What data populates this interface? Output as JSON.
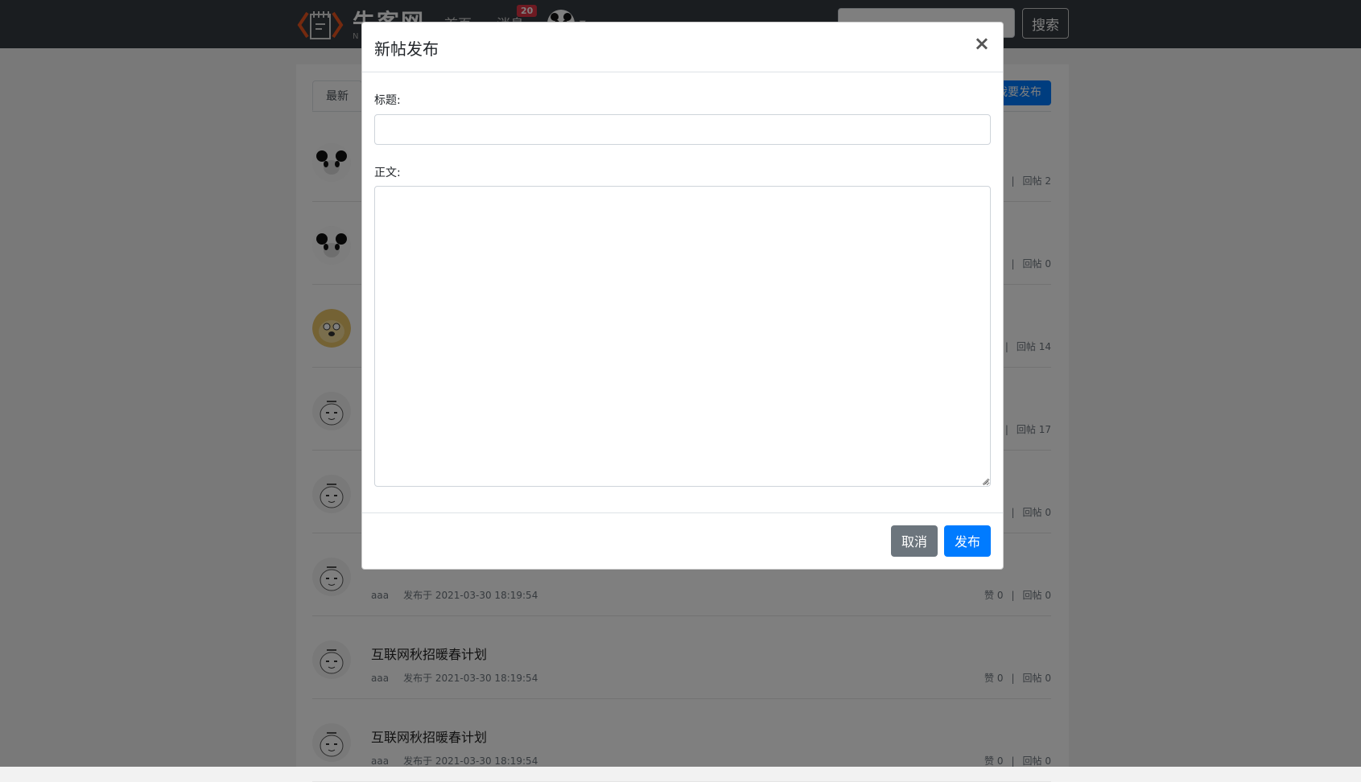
{
  "navbar": {
    "logo_text": "牛客网",
    "logo_sub": "N",
    "home_label": "首页",
    "messages_label": "消息",
    "messages_badge": "20",
    "search_button": "搜索"
  },
  "content": {
    "tab_latest": "最新",
    "publish_button": "我要发布",
    "posts": [
      {
        "title": "",
        "author": "",
        "time": "",
        "likes": "",
        "replies": "回帖 2",
        "avatar": "panda-avatar"
      },
      {
        "title": "",
        "author": "",
        "time": "",
        "likes": "",
        "replies": "回帖 0",
        "avatar": "panda-avatar"
      },
      {
        "title": "",
        "author": "",
        "time": "",
        "likes": "",
        "replies": "回帖 14",
        "avatar": "doge-avatar"
      },
      {
        "title": "",
        "author": "",
        "time": "",
        "likes": "",
        "replies": "回帖 17",
        "avatar": "sketch-avatar"
      },
      {
        "title": "",
        "author": "",
        "time": "",
        "likes": "",
        "replies": "回帖 0",
        "avatar": "sketch-avatar"
      },
      {
        "title": "",
        "author": "aaa",
        "time": "发布于 2021-03-30 18:19:54",
        "likes": "赞 0",
        "replies": "回帖 0",
        "avatar": "sketch-avatar"
      },
      {
        "title": "互联网秋招暖春计划",
        "author": "aaa",
        "time": "发布于 2021-03-30 18:19:54",
        "likes": "赞 0",
        "replies": "回帖 0",
        "avatar": "sketch-avatar"
      },
      {
        "title": "互联网秋招暖春计划",
        "author": "aaa",
        "time": "发布于 2021-03-30 18:19:54",
        "likes": "赞 0",
        "replies": "回帖 0",
        "avatar": "sketch-avatar"
      }
    ]
  },
  "modal": {
    "title": "新帖发布",
    "close_symbol": "×",
    "label_title": "标题:",
    "label_body": "正文:",
    "title_value": "",
    "body_value": "",
    "cancel_button": "取消",
    "submit_button": "发布"
  }
}
